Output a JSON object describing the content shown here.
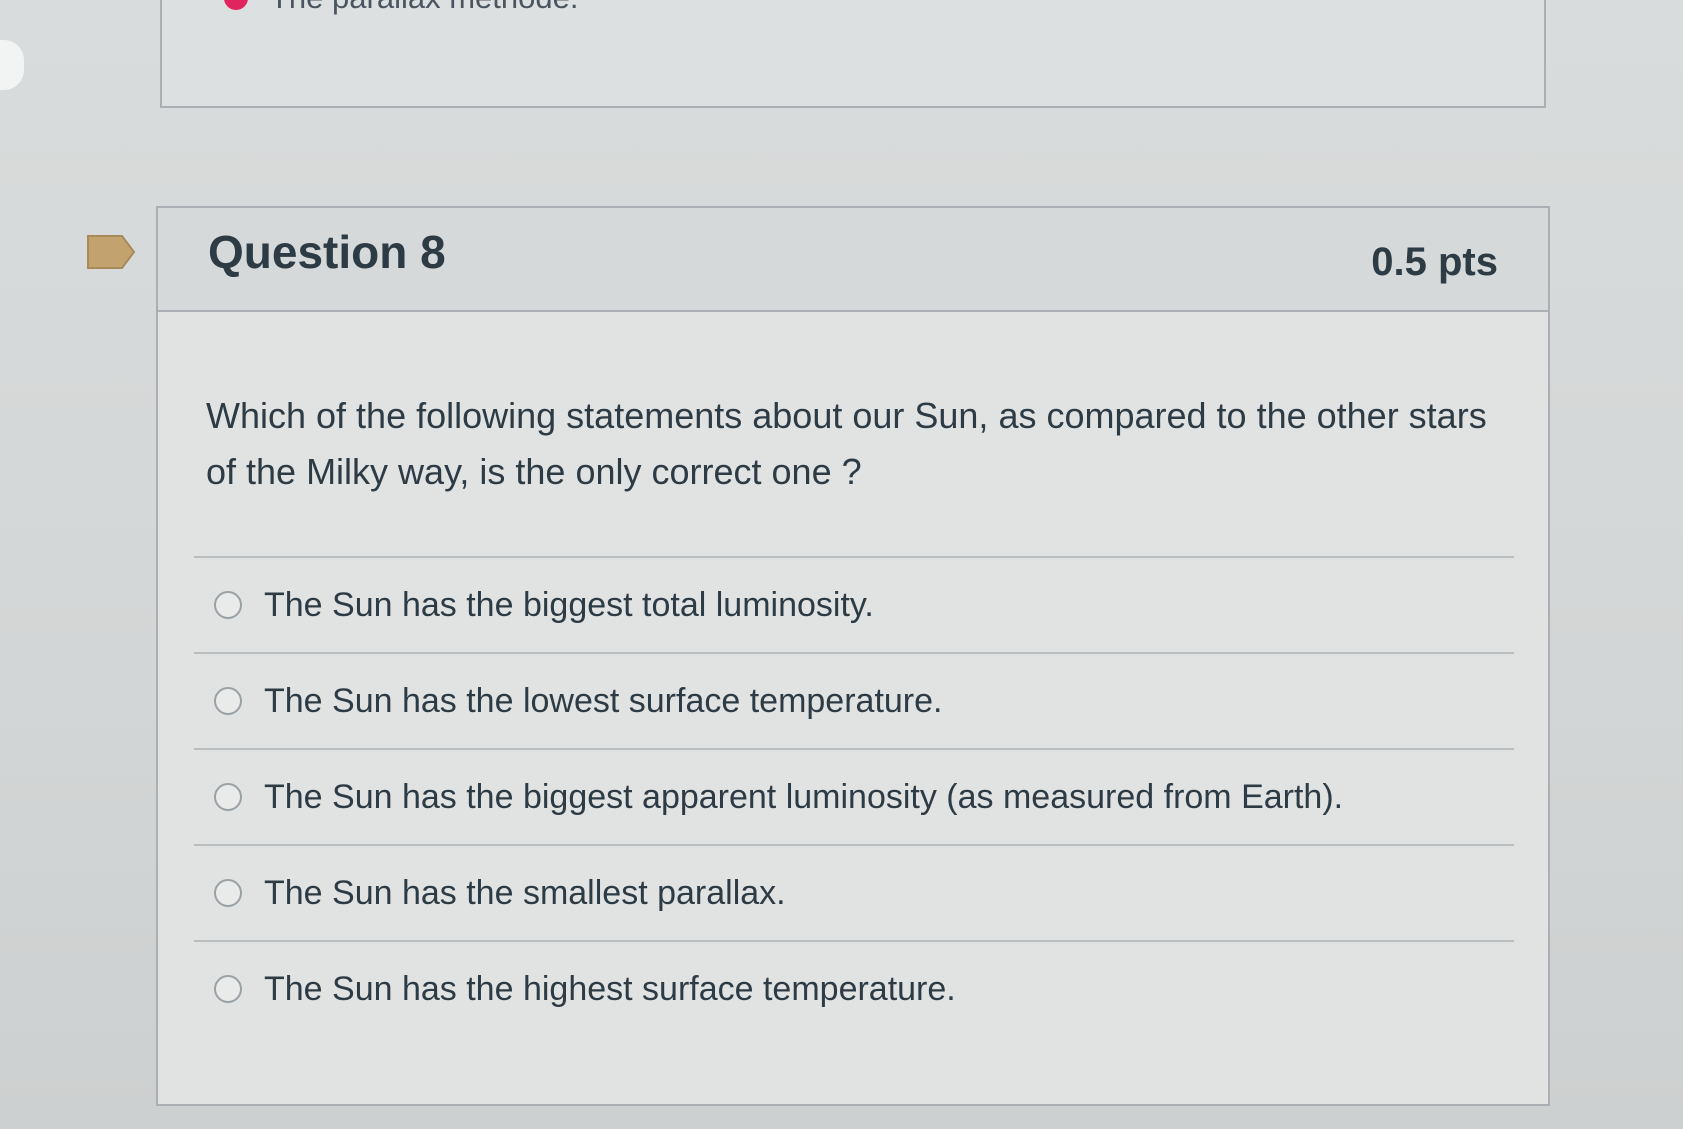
{
  "previous_question": {
    "answer_text": "The parallax methode."
  },
  "question": {
    "title": "Question 8",
    "points": "0.5 pts",
    "text": "Which of the following statements about our Sun, as compared to the other stars of the Milky way,  is the only correct one ?",
    "answers": [
      "The Sun has the biggest total luminosity.",
      "The Sun has the lowest surface temperature.",
      "The Sun has the biggest apparent luminosity (as measured from Earth).",
      "The Sun has the smallest parallax.",
      "The Sun has the highest surface temperature."
    ]
  },
  "colors": {
    "flag": "#c2a36e",
    "selected_dot": "#e0245e"
  }
}
